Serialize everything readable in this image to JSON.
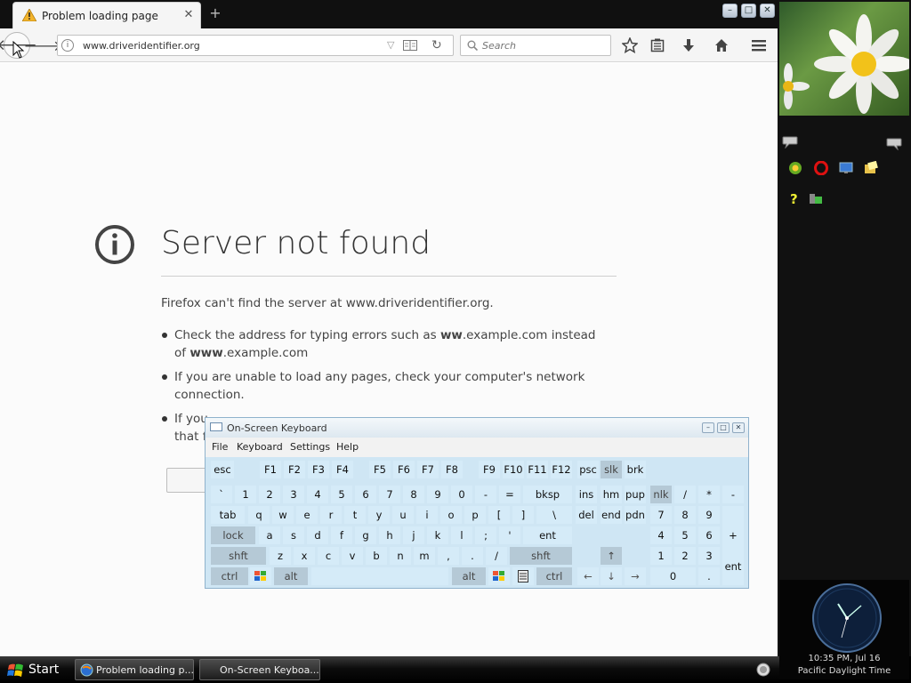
{
  "browser": {
    "tab_title": "Problem loading page",
    "tab_close": "✕",
    "new_tab": "+",
    "url": "www.driveridentifier.org",
    "search_placeholder": "Search",
    "window_buttons": [
      "–",
      "□",
      "✕"
    ]
  },
  "error_page": {
    "title": "Server not found",
    "message": "Firefox can't find the server at www.driveridentifier.org.",
    "items": [
      {
        "before": "Check the address for typing errors such as ",
        "bold1": "ww",
        "mid": ".example.com instead of ",
        "bold2": "www",
        "after": ".example.com"
      },
      {
        "text": "If you are unable to load any pages, check your computer's network connection."
      },
      {
        "text": "If you",
        "line2": "that f"
      }
    ]
  },
  "osk": {
    "title": "On-Screen Keyboard",
    "menu": [
      "File",
      "Keyboard",
      "Settings",
      "Help"
    ],
    "row_fn": [
      "esc",
      "F1",
      "F2",
      "F3",
      "F4",
      "F5",
      "F6",
      "F7",
      "F8",
      "F9",
      "F10",
      "F11",
      "F12",
      "psc",
      "slk",
      "brk"
    ],
    "row_num": [
      "`",
      "1",
      "2",
      "3",
      "4",
      "5",
      "6",
      "7",
      "8",
      "9",
      "0",
      "-",
      "=",
      "bksp",
      "ins",
      "hm",
      "pup",
      "nlk",
      "/",
      "*",
      "-"
    ],
    "row_q": [
      "tab",
      "q",
      "w",
      "e",
      "r",
      "t",
      "y",
      "u",
      "i",
      "o",
      "p",
      "[",
      "]",
      "\\",
      "del",
      "end",
      "pdn",
      "7",
      "8",
      "9"
    ],
    "row_a": [
      "lock",
      "a",
      "s",
      "d",
      "f",
      "g",
      "h",
      "j",
      "k",
      "l",
      ";",
      "'",
      "ent",
      "4",
      "5",
      "6",
      "+"
    ],
    "row_z": [
      "shft",
      "z",
      "x",
      "c",
      "v",
      "b",
      "n",
      "m",
      ",",
      ".",
      "/",
      "shft",
      "↑",
      "1",
      "2",
      "3"
    ],
    "row_b": [
      "ctrl",
      "alt",
      "alt",
      "ctrl",
      "←",
      "↓",
      "→",
      "0",
      ".",
      "ent"
    ]
  },
  "sidebar": {
    "clock_time": "10:35 PM, Jul 16",
    "clock_tz": "Pacific Daylight Time"
  },
  "taskbar": {
    "start": "Start",
    "tasks": [
      "Problem loading p...",
      "On-Screen Keyboa..."
    ]
  }
}
